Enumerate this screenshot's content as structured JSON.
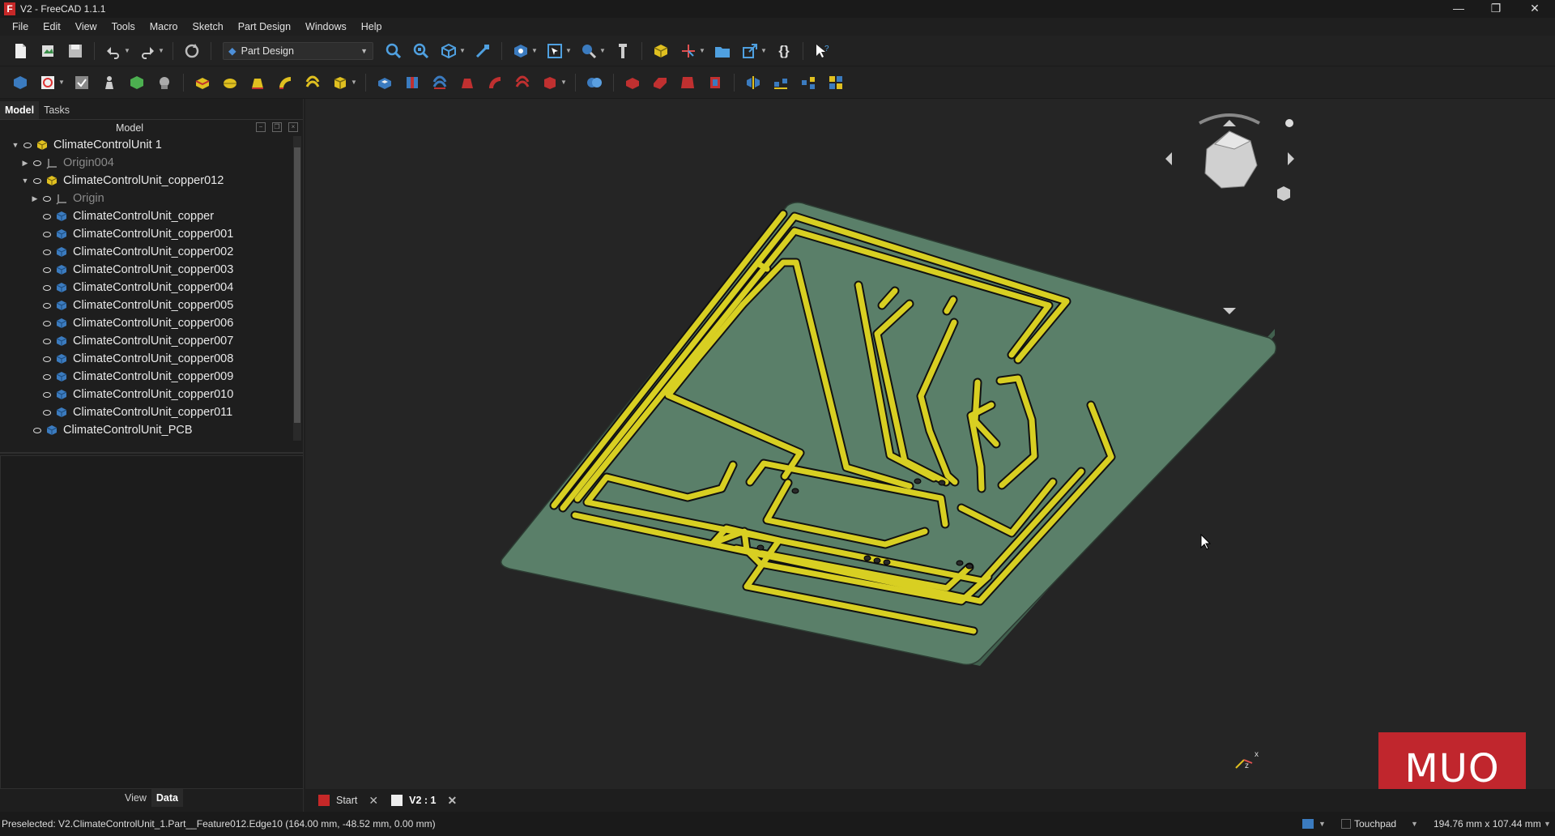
{
  "window": {
    "title": "V2 - FreeCAD 1.1.1",
    "app_icon": "F"
  },
  "menu": [
    "File",
    "Edit",
    "View",
    "Tools",
    "Macro",
    "Sketch",
    "Part Design",
    "Windows",
    "Help"
  ],
  "toolbar": {
    "workbench": "Part Design"
  },
  "panel": {
    "tabs": [
      "Model",
      "Tasks"
    ],
    "tree_header": "Model",
    "tree": [
      {
        "label": "ClimateControlUnit 1",
        "level": 0,
        "expanded": true,
        "icon": "part-icon"
      },
      {
        "label": "Origin004",
        "level": 1,
        "expanded": false,
        "icon": "origin-icon",
        "dim": true
      },
      {
        "label": "ClimateControlUnit_copper012",
        "level": 1,
        "expanded": true,
        "icon": "part-icon"
      },
      {
        "label": "Origin",
        "level": 2,
        "expanded": false,
        "icon": "origin-icon",
        "dim": true
      },
      {
        "label": "ClimateControlUnit_copper",
        "level": 2,
        "icon": "body-icon"
      },
      {
        "label": "ClimateControlUnit_copper001",
        "level": 2,
        "icon": "body-icon"
      },
      {
        "label": "ClimateControlUnit_copper002",
        "level": 2,
        "icon": "body-icon"
      },
      {
        "label": "ClimateControlUnit_copper003",
        "level": 2,
        "icon": "body-icon"
      },
      {
        "label": "ClimateControlUnit_copper004",
        "level": 2,
        "icon": "body-icon"
      },
      {
        "label": "ClimateControlUnit_copper005",
        "level": 2,
        "icon": "body-icon"
      },
      {
        "label": "ClimateControlUnit_copper006",
        "level": 2,
        "icon": "body-icon"
      },
      {
        "label": "ClimateControlUnit_copper007",
        "level": 2,
        "icon": "body-icon"
      },
      {
        "label": "ClimateControlUnit_copper008",
        "level": 2,
        "icon": "body-icon"
      },
      {
        "label": "ClimateControlUnit_copper009",
        "level": 2,
        "icon": "body-icon"
      },
      {
        "label": "ClimateControlUnit_copper010",
        "level": 2,
        "icon": "body-icon"
      },
      {
        "label": "ClimateControlUnit_copper011",
        "level": 2,
        "icon": "body-icon"
      },
      {
        "label": "ClimateControlUnit_PCB",
        "level": 1,
        "icon": "body-icon"
      }
    ],
    "prop_tabs": [
      "View",
      "Data"
    ]
  },
  "doc_tabs": [
    {
      "label": "Start",
      "active": false
    },
    {
      "label": "V2 : 1",
      "active": true
    }
  ],
  "status": {
    "message": "Preselected: V2.ClimateControlUnit_1.Part__Feature012.Edge10 (164.00 mm, -48.52 mm, 0.00 mm)",
    "navigation": "Touchpad",
    "dimensions": "194.76 mm x 107.44 mm"
  },
  "watermark": "MUO",
  "colors": {
    "pcb": "#5a7f69",
    "copper": "#d8cf22",
    "background": "#252525"
  }
}
